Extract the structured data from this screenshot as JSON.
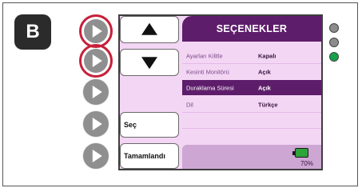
{
  "figure_label": "B",
  "screen": {
    "title": "SEÇENEKLER",
    "side_buttons": {
      "select_label": "Seç",
      "done_label": "Tamamlandı"
    },
    "options": [
      {
        "label": "Ayarları Kilitle",
        "value": "Kapalı"
      },
      {
        "label": "Kesinti Monitörü",
        "value": "Açık"
      },
      {
        "label": "Duraklama Süresi",
        "value": "Açık"
      },
      {
        "label": "Dil",
        "value": "Türkçe"
      }
    ],
    "selected_option": "Duraklama Süresi",
    "battery": {
      "percent_label": "70%",
      "level": 0.7,
      "color": "#2fa43a"
    }
  },
  "indicator_leds": [
    {
      "state": "off",
      "color": "#8c8c8c"
    },
    {
      "state": "off",
      "color": "#8c8c8c"
    },
    {
      "state": "on",
      "color": "#17a04a"
    }
  ],
  "colors": {
    "accent": "#5e1d6b",
    "highlight_ring": "#c62039",
    "screen_bg": "#f3d6f4"
  }
}
